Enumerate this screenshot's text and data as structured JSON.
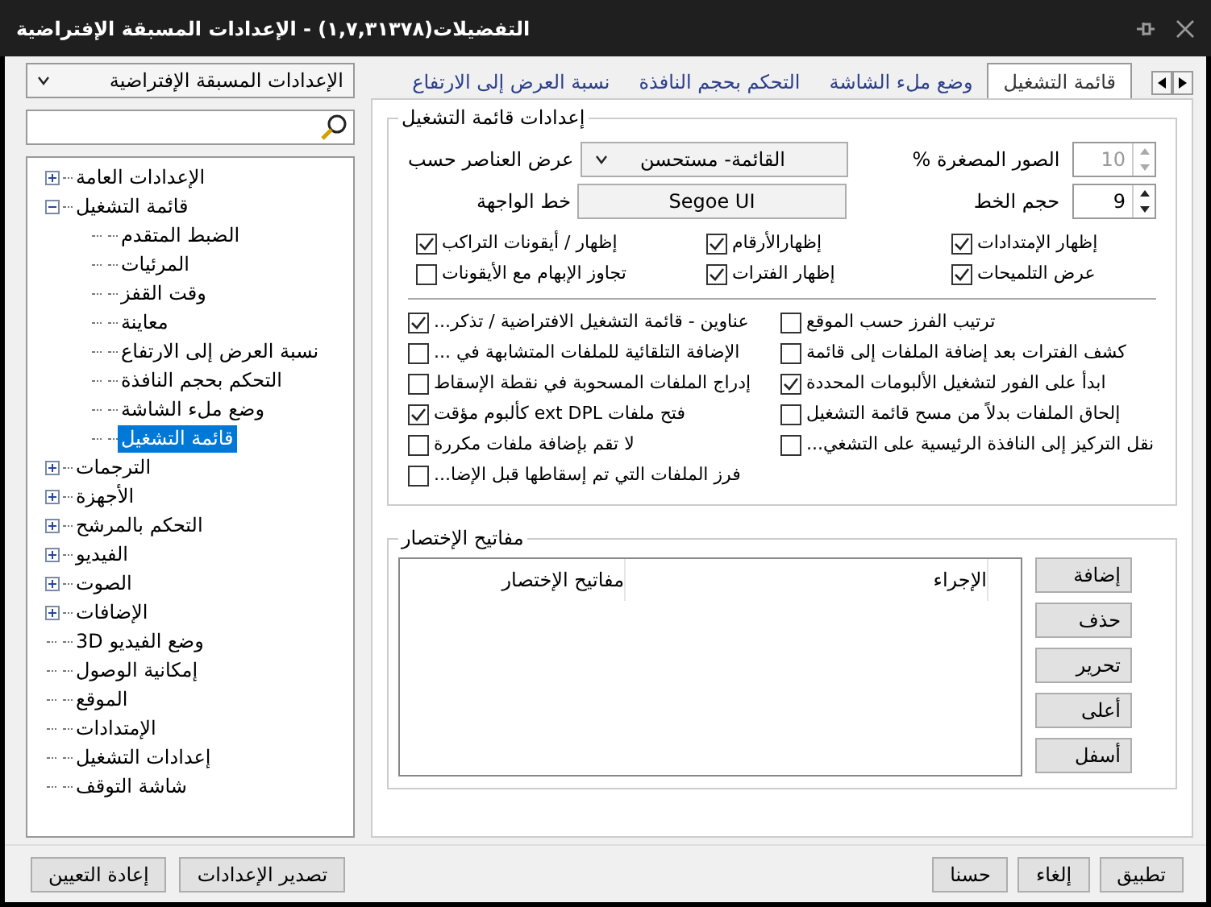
{
  "window": {
    "title": "التفضيلات(١,٧,٣١٣٧٨) - الإعدادات المسبقة الإفتراضية"
  },
  "sidebar": {
    "preset": "الإعدادات المسبقة الإفتراضية",
    "tree": [
      {
        "label": "الإعدادات العامة",
        "kind": "group",
        "expanded": false,
        "selected": false
      },
      {
        "label": "قائمة التشغيل",
        "kind": "group",
        "expanded": true,
        "selected": false,
        "children": [
          {
            "label": "الضبط المتقدم",
            "selected": false
          },
          {
            "label": "المرئيات",
            "selected": false
          },
          {
            "label": "وقت القفز",
            "selected": false
          },
          {
            "label": "معاينة",
            "selected": false
          },
          {
            "label": "نسبة العرض إلى الارتفاع",
            "selected": false
          },
          {
            "label": "التحكم بحجم النافذة",
            "selected": false
          },
          {
            "label": "وضع ملء الشاشة",
            "selected": false
          },
          {
            "label": "قائمة التشغيل",
            "selected": true
          }
        ]
      },
      {
        "label": "الترجمات",
        "kind": "group",
        "expanded": false,
        "selected": false
      },
      {
        "label": "الأجهزة",
        "kind": "group",
        "expanded": false,
        "selected": false
      },
      {
        "label": "التحكم بالمرشح",
        "kind": "group",
        "expanded": false,
        "selected": false
      },
      {
        "label": "الفيديو",
        "kind": "group",
        "expanded": false,
        "selected": false
      },
      {
        "label": "الصوت",
        "kind": "group",
        "expanded": false,
        "selected": false
      },
      {
        "label": "الإضافات",
        "kind": "group",
        "expanded": false,
        "selected": false
      },
      {
        "label": "وضع الفيديو 3D",
        "kind": "leaf",
        "selected": false
      },
      {
        "label": "إمكانية الوصول",
        "kind": "leaf",
        "selected": false
      },
      {
        "label": "الموقع",
        "kind": "leaf",
        "selected": false
      },
      {
        "label": "الإمتدادات",
        "kind": "leaf",
        "selected": false
      },
      {
        "label": "إعدادات التشغيل",
        "kind": "leaf",
        "selected": false
      },
      {
        "label": "شاشة التوقف",
        "kind": "leaf",
        "selected": false
      }
    ],
    "buttons": [
      "تصدير الإعدادات",
      "إعادة التعيين"
    ]
  },
  "tabs": [
    {
      "label": "قائمة التشغيل",
      "selected": true
    },
    {
      "label": "وضع ملء الشاشة",
      "selected": false
    },
    {
      "label": "التحكم بحجم النافذة",
      "selected": false
    },
    {
      "label": "نسبة العرض إلى الارتفاع",
      "selected": false
    }
  ],
  "playlist_group": {
    "title": "إعدادات قائمة التشغيل",
    "thumbnails": {
      "label": "الصور المصغرة %",
      "value": "10",
      "disabled": true
    },
    "view_by": {
      "label": "عرض العناصر حسب",
      "value": "القائمة- مستحسن"
    },
    "font_size": {
      "label": "حجم الخط",
      "value": "9",
      "disabled": false
    },
    "ui_font": {
      "label": "خط الواجهة",
      "value": "Segoe UI"
    },
    "options": [
      {
        "label": "إظهار الإمتدادات",
        "checked": true
      },
      {
        "label": "إظهارالأرقام",
        "checked": true
      },
      {
        "label": "إظهار / أيقونات التراكب",
        "checked": true
      },
      {
        "label": "عرض التلميحات",
        "checked": true
      },
      {
        "label": "إظهار الفترات",
        "checked": true
      },
      {
        "label": "تجاوز الإبهام مع الأيقونات",
        "checked": false
      }
    ],
    "columns": [
      [
        {
          "label": "ترتيب الفرز حسب الموقع",
          "checked": false
        },
        {
          "label": "كشف الفترات بعد إضافة الملفات إلى قائمة",
          "checked": false
        },
        {
          "label": "ابدأ على الفور لتشغيل الألبومات المحددة",
          "checked": true
        },
        {
          "label": "إلحاق الملفات بدلاً من مسح قائمة التشغيل",
          "checked": false
        },
        {
          "label": "نقل التركيز إلى النافذة الرئيسية على التشغي...",
          "checked": false
        }
      ],
      [
        {
          "label": "عناوين - قائمة التشغيل الافتراضية / تذكر...",
          "checked": true
        },
        {
          "label": "الإضافة التلقائية للملفات المتشابهة في ...",
          "checked": false
        },
        {
          "label": "إدراج الملفات المسحوبة في نقطة الإسقاط",
          "checked": false
        },
        {
          "label": "فتح ملفات ext DPL كألبوم مؤقت",
          "checked": true
        },
        {
          "label": "لا تقم بإضافة ملفات مكررة",
          "checked": false
        },
        {
          "label": "فرز الملفات التي تم إسقاطها قبل الإضا...",
          "checked": false
        }
      ]
    ]
  },
  "shortcuts_group": {
    "title": "مفاتيح الإختصار",
    "columns": [
      "الإجراء",
      "مفاتيح الإختصار"
    ],
    "buttons": [
      "إضافة",
      "حذف",
      "تحرير",
      "أعلى",
      "أسفل"
    ]
  },
  "footer_buttons": [
    "تطبيق",
    "إلغاء",
    "حسنا"
  ]
}
